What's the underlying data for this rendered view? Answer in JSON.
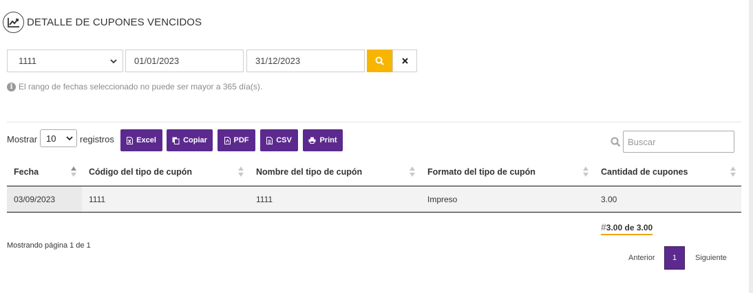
{
  "header": {
    "title": "DETALLE DE CUPONES VENCIDOS",
    "icon": "chart-line-icon"
  },
  "filters": {
    "coupon_type_selected": "1111",
    "date_from": "01/01/2023",
    "date_to": "31/12/2023",
    "search_color": "#f7b500",
    "hint": "El rango de fechas seleccionado no puede ser mayor a 365 día(s)."
  },
  "controls": {
    "show_label": "Mostrar",
    "page_length": "10",
    "records_label": "registros",
    "buttons": [
      "Excel",
      "Copiar",
      "PDF",
      "CSV",
      "Print"
    ],
    "button_color": "#5c2a8e",
    "search_placeholder": "Buscar"
  },
  "table": {
    "columns": [
      "Fecha",
      "Código del tipo de cupón",
      "Nombre del tipo de cupón",
      "Formato del tipo de cupón",
      "Cantidad de cupones"
    ],
    "rows": [
      [
        "03/09/2023",
        "1111",
        "1111",
        "Impreso",
        "3.00"
      ]
    ],
    "total_hash": "#",
    "total": "3.00 de 3.00"
  },
  "pagination": {
    "info": "Mostrando página 1 de 1",
    "previous": "Anterior",
    "current": "1",
    "next": "Siguiente"
  }
}
